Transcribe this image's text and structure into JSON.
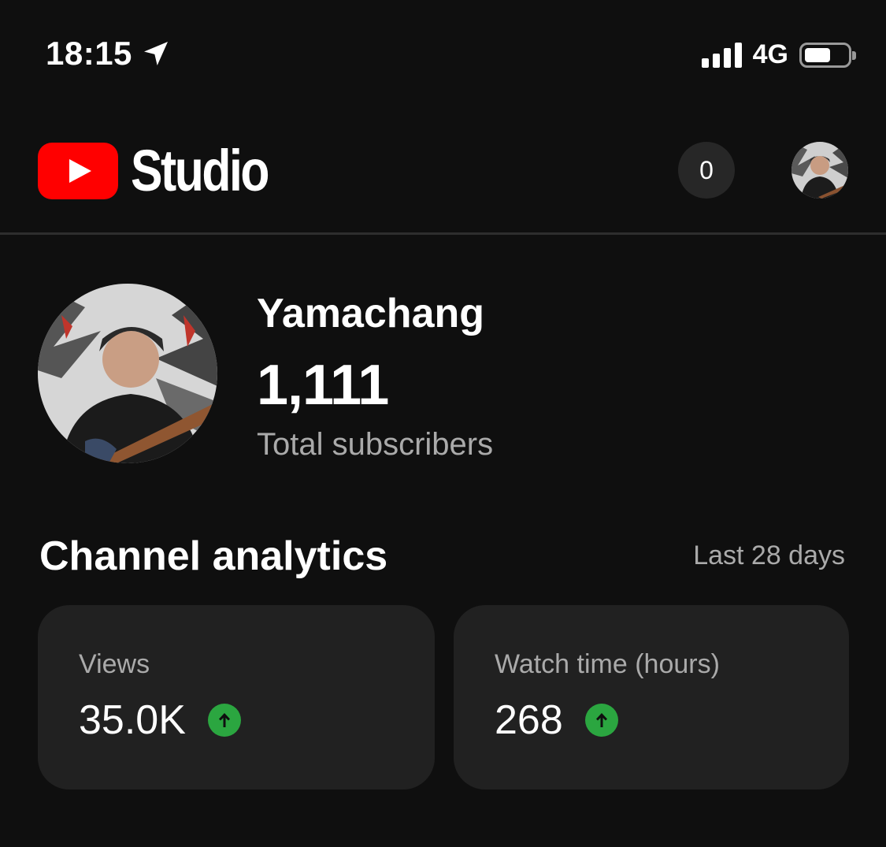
{
  "status_bar": {
    "time": "18:15",
    "network": "4G",
    "location_icon": "location-arrow-icon",
    "signal_icon": "signal-bars-icon",
    "battery_icon": "battery-icon"
  },
  "header": {
    "logo_text": "Studio",
    "logo_icon": "youtube-play-icon",
    "notifications_count": "0",
    "accent_color": "#ff0000"
  },
  "channel": {
    "name": "Yamachang",
    "subscriber_count": "1,111",
    "subscriber_label": "Total subscribers"
  },
  "analytics": {
    "title": "Channel analytics",
    "range": "Last 28 days",
    "cards": [
      {
        "label": "Views",
        "value": "35.0K",
        "trend_icon": "arrow-up-icon",
        "trend_color": "#2ba640"
      },
      {
        "label": "Watch time (hours)",
        "value": "268",
        "trend_icon": "arrow-up-icon",
        "trend_color": "#2ba640"
      }
    ]
  }
}
